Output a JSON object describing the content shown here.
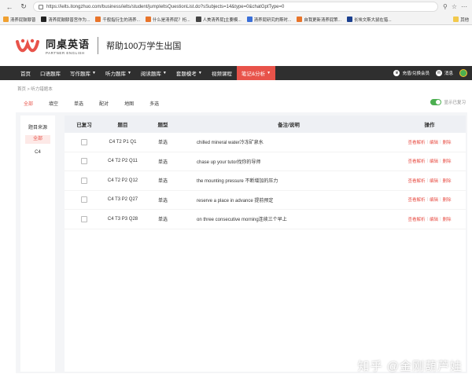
{
  "browser": {
    "url": "https://ielts.itongzhuo.com/business/ielts/student/jumpIeltsQuestionList.do?sSubjects=14&type=0&chatGptType=0",
    "bookmarks": [
      {
        "label": "清养屁鼓醪普",
        "color": "#f0a030"
      },
      {
        "label": "清养屁鼓醪普宫作为...",
        "color": "#222222"
      },
      {
        "label": "千般指衍生的清养...",
        "color": "#e8742a"
      },
      {
        "label": "什么是清养屁？桁...",
        "color": "#e8742a"
      },
      {
        "label": "人美清养屁[主要模...",
        "color": "#444444"
      },
      {
        "label": "清养屁研究的斯时...",
        "color": "#3a6fd8"
      },
      {
        "label": "自我更新清养屁策...",
        "color": "#e8742a"
      },
      {
        "label": "长埃文斯大鼠在猎...",
        "color": "#1a3f8f"
      }
    ],
    "more_bookmarks": "其他"
  },
  "site": {
    "logo_cn": "同桌英语",
    "logo_en": "PARTNER ENGLISH",
    "slogan": "帮助100万学生出国"
  },
  "nav": {
    "items": [
      {
        "label": "首页",
        "caret": false,
        "active": false
      },
      {
        "label": "口语题库",
        "caret": false,
        "active": false
      },
      {
        "label": "写作题库",
        "caret": true,
        "active": false
      },
      {
        "label": "听力题库",
        "caret": true,
        "active": false
      },
      {
        "label": "阅读题库",
        "caret": true,
        "active": false
      },
      {
        "label": "套题模考",
        "caret": true,
        "active": false
      },
      {
        "label": "视频课程",
        "caret": false,
        "active": false
      },
      {
        "label": "笔记&分析",
        "caret": true,
        "active": true
      }
    ],
    "caret_glyph": "▼",
    "recharge": "充值/兑换会员",
    "messages": "消息"
  },
  "breadcrumb": "首页 > 听力错题本",
  "tabs": [
    "全部",
    "填空",
    "单选",
    "配对",
    "地图",
    "多选"
  ],
  "active_tab": 0,
  "toggle_label": "显示已复习",
  "sidebar": {
    "title": "题目来源",
    "items": [
      "全部",
      "C4"
    ],
    "active_index": 0
  },
  "table": {
    "headers": {
      "reviewed": "已复习",
      "question": "题目",
      "type": "题型",
      "note": "备注/说明",
      "action": "操作"
    },
    "rows": [
      {
        "question": "C4 T2 P1 Q1",
        "type": "单选",
        "note": "chilled mineral water冷冻矿泉水"
      },
      {
        "question": "C4 T2 P2 Q11",
        "type": "单选",
        "note": "chase up your tutor找你的导师"
      },
      {
        "question": "C4 T2 P2 Q12",
        "type": "单选",
        "note": "the mounting pressure 不断增加的压力"
      },
      {
        "question": "C4 T3 P2 Q27",
        "type": "单选",
        "note": "reserve a place in advance 提前预定"
      },
      {
        "question": "C4 T3 P3 Q28",
        "type": "单选",
        "note": "on three consecutive morning连续三个早上"
      }
    ],
    "actions": {
      "view": "查看解析",
      "edit": "编辑",
      "delete": "删除",
      "separator": "|"
    }
  },
  "watermark": "知乎 @金刚葫芦娃",
  "colors": {
    "accent": "#e8534a",
    "nav_bg": "#2f2f2f",
    "toggle_on": "#4caf50",
    "content_bg": "#f4f5f7"
  }
}
